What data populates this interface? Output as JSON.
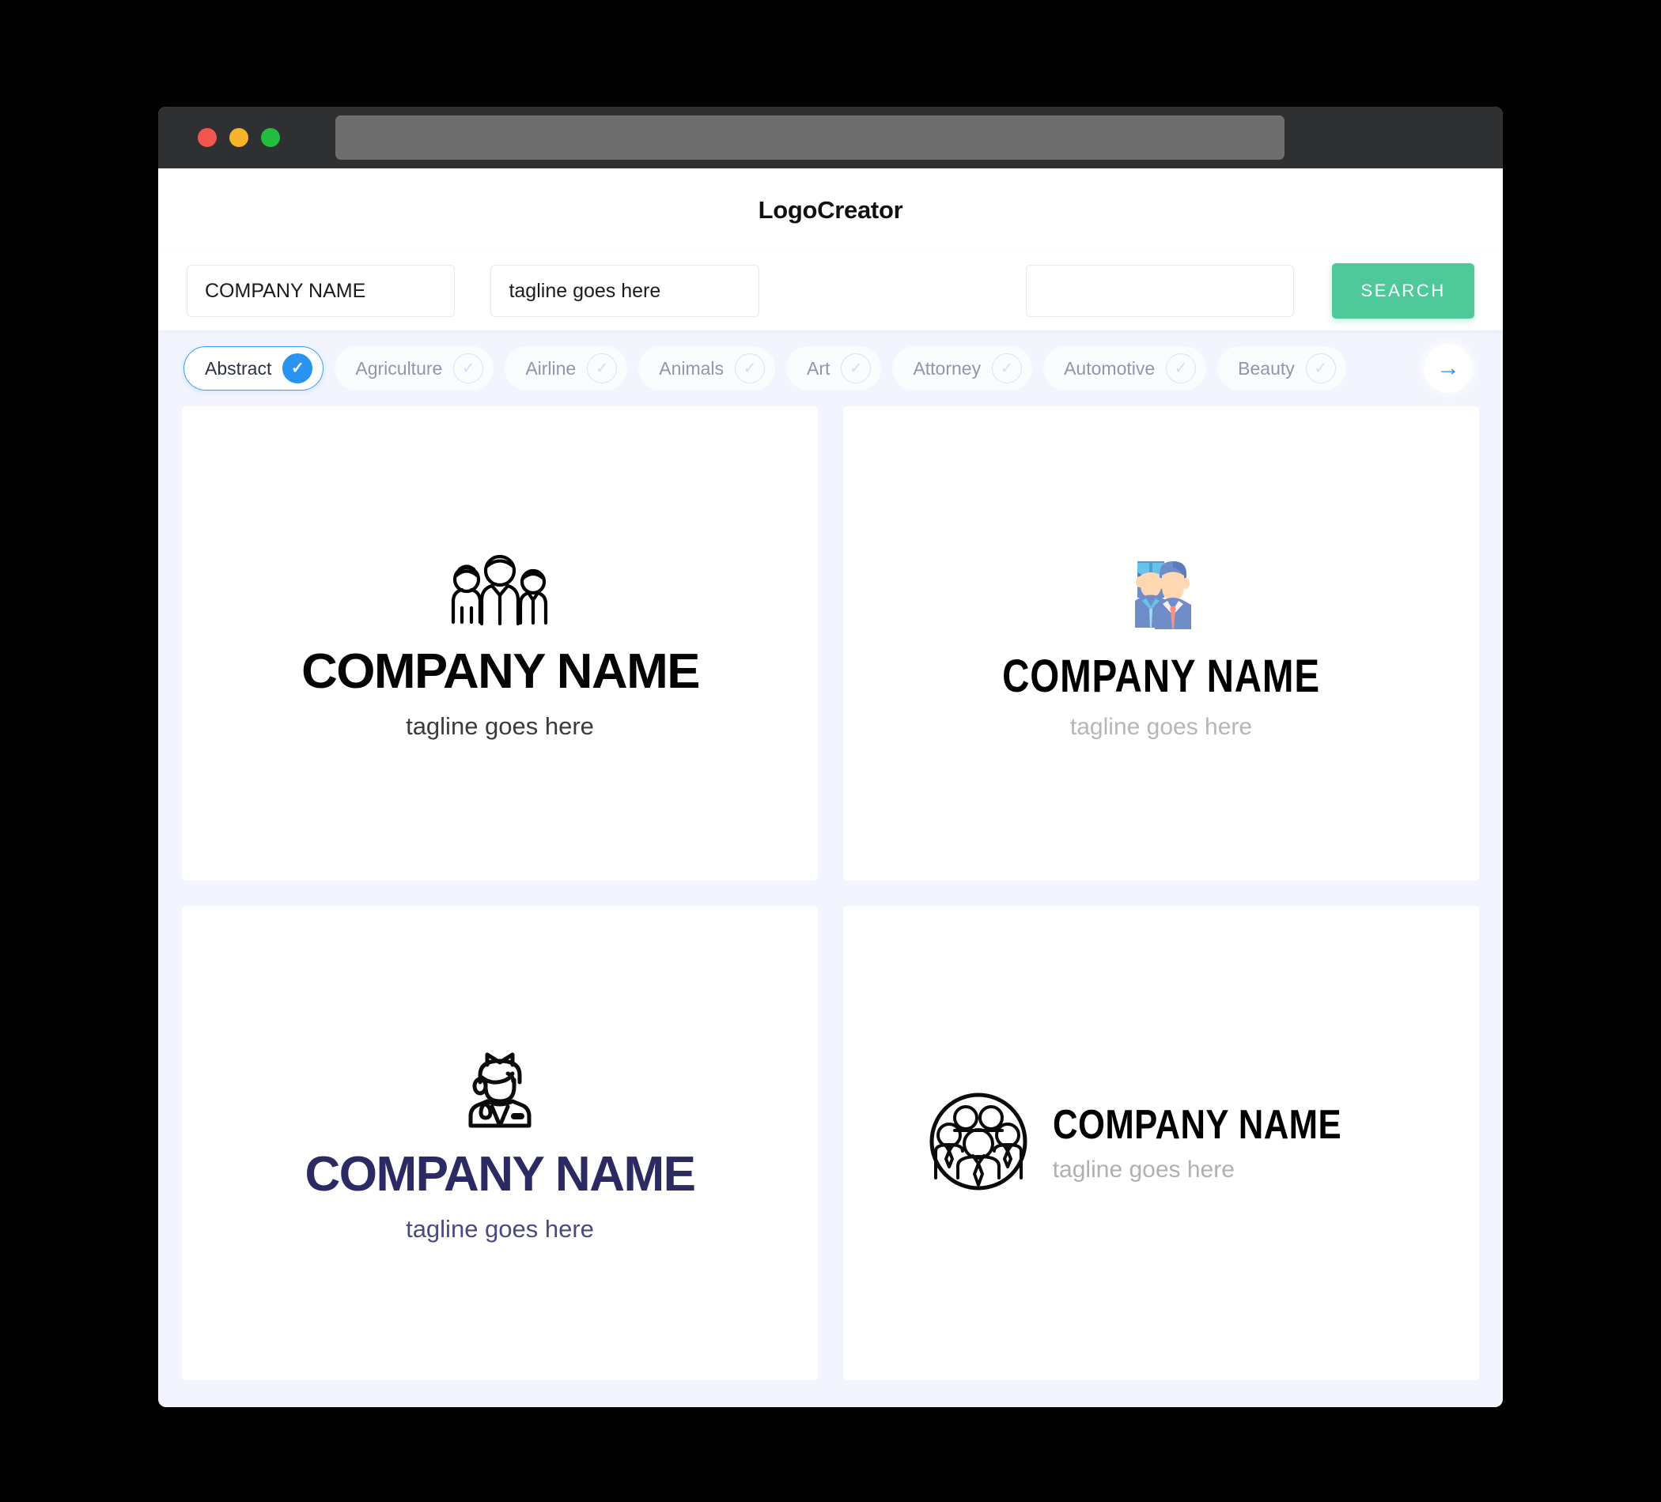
{
  "window": {
    "traffic_lights": [
      "close-red",
      "minimize-yellow",
      "maximize-green"
    ],
    "url_value": ""
  },
  "header": {
    "title": "LogoCreator"
  },
  "search": {
    "company_value": "COMPANY NAME",
    "company_placeholder": "COMPANY NAME",
    "tagline_value": "tagline goes here",
    "tagline_placeholder": "tagline goes here",
    "extra_value": "",
    "extra_placeholder": "",
    "button_label": "SEARCH",
    "button_color": "#4fc99a"
  },
  "categories": {
    "next_arrow_icon": "arrow-right-icon",
    "active_color": "#2a93f0",
    "items": [
      {
        "label": "Abstract",
        "selected": true
      },
      {
        "label": "Agriculture",
        "selected": false
      },
      {
        "label": "Airline",
        "selected": false
      },
      {
        "label": "Animals",
        "selected": false
      },
      {
        "label": "Art",
        "selected": false
      },
      {
        "label": "Attorney",
        "selected": false
      },
      {
        "label": "Automotive",
        "selected": false
      },
      {
        "label": "Beauty",
        "selected": false
      }
    ]
  },
  "logos": [
    {
      "icon": "three-people-outline-icon",
      "name": "COMPANY NAME",
      "tagline": "tagline goes here",
      "name_color": "#050505",
      "tagline_color": "#3b3b3b",
      "layout": "stacked"
    },
    {
      "icon": "flight-crew-flat-icon",
      "name": "COMPANY NAME",
      "tagline": "tagline goes here",
      "name_color": "#000000",
      "tagline_color": "#b6b6b6",
      "layout": "stacked"
    },
    {
      "icon": "stewardess-outline-icon",
      "name": "COMPANY NAME",
      "tagline": "tagline goes here",
      "name_color": "#2c2a63",
      "tagline_color": "#4b4a80",
      "layout": "stacked"
    },
    {
      "icon": "team-circle-outline-icon",
      "name": "COMPANY NAME",
      "tagline": "tagline goes here",
      "name_color": "#000000",
      "tagline_color": "#b0b0b0",
      "layout": "horizontal"
    }
  ]
}
